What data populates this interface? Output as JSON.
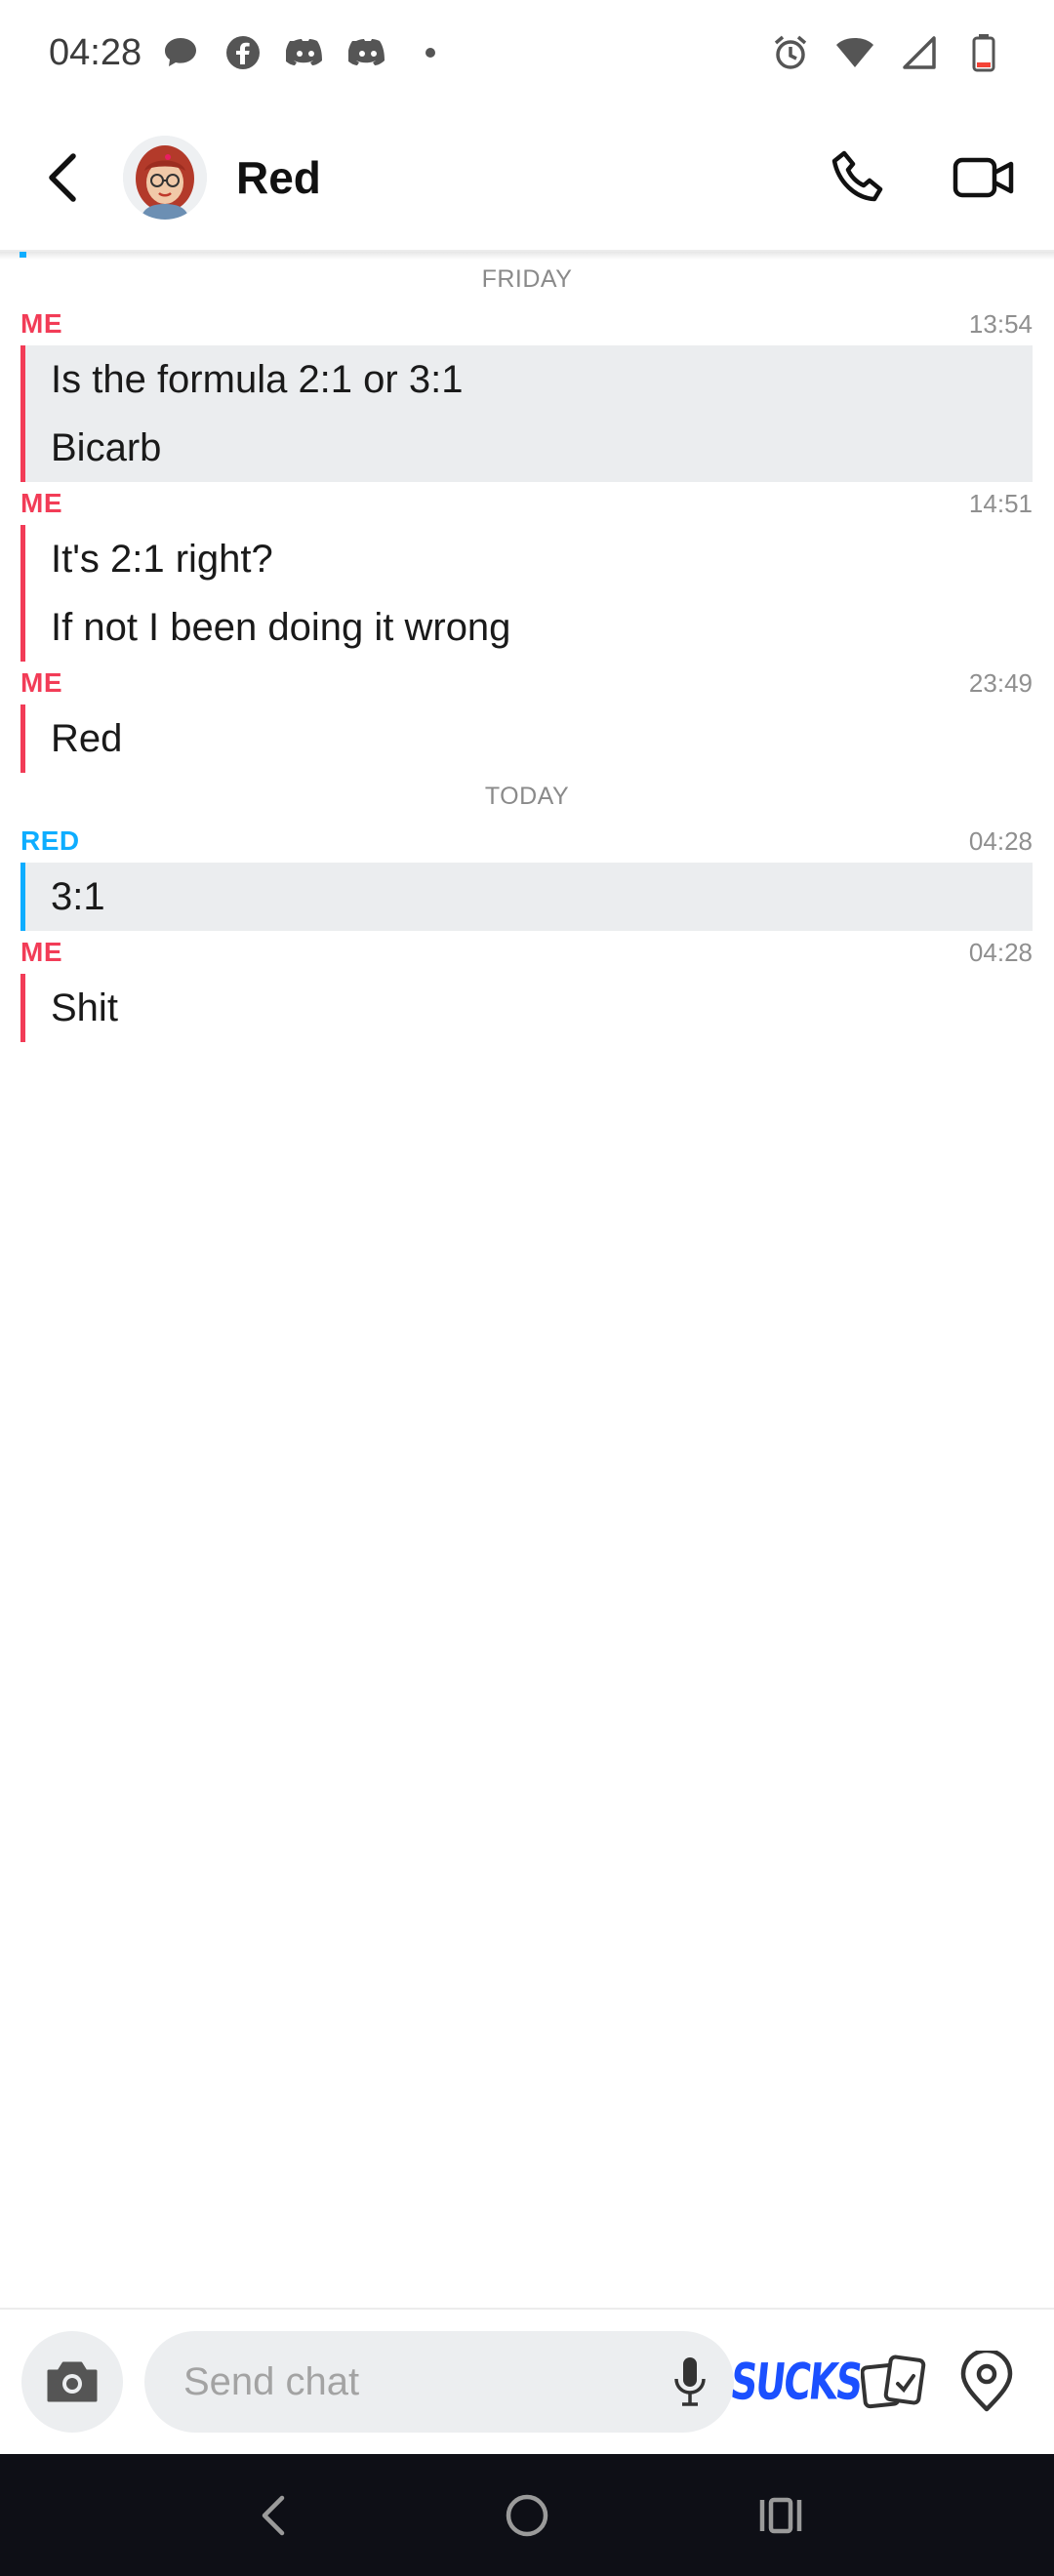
{
  "status_bar": {
    "time": "04:28",
    "left_icons": [
      "chat-bubble-icon",
      "facebook-icon",
      "discord-icon",
      "discord-icon",
      "dot-icon"
    ],
    "right_icons": [
      "alarm-icon",
      "wifi-icon",
      "cell-signal-icon",
      "battery-low-icon"
    ]
  },
  "header": {
    "title": "Red",
    "back_icon": "chevron-left-icon",
    "call_icon": "phone-icon",
    "video_icon": "video-camera-icon"
  },
  "chat": {
    "groups": [
      {
        "day_label": "FRIDAY",
        "messages": [
          {
            "sender": "ME",
            "time": "13:54",
            "lines": [
              "Is the formula 2:1 or 3:1",
              "Bicarb"
            ],
            "highlighted": true
          },
          {
            "sender": "ME",
            "time": "14:51",
            "lines": [
              "It's 2:1 right?",
              "If not I been doing it wrong"
            ],
            "highlighted": false
          },
          {
            "sender": "ME",
            "time": "23:49",
            "lines": [
              "Red"
            ],
            "highlighted": false
          }
        ]
      },
      {
        "day_label": "TODAY",
        "messages": [
          {
            "sender": "RED",
            "time": "04:28",
            "lines": [
              "3:1"
            ],
            "highlighted": true
          },
          {
            "sender": "ME",
            "time": "04:28",
            "lines": [
              "Shit"
            ],
            "highlighted": false
          }
        ]
      }
    ]
  },
  "composer": {
    "placeholder": "Send chat",
    "camera_icon": "camera-icon",
    "mic_icon": "microphone-icon",
    "sticker_text": "SUCKS",
    "cards_icon": "cards-icon",
    "map_icon": "map-pin-icon"
  },
  "colors": {
    "me": "#f23c57",
    "friend": "#0eadff",
    "highlight_bg": "#ebedef",
    "nav_bg": "#0e0f16"
  }
}
